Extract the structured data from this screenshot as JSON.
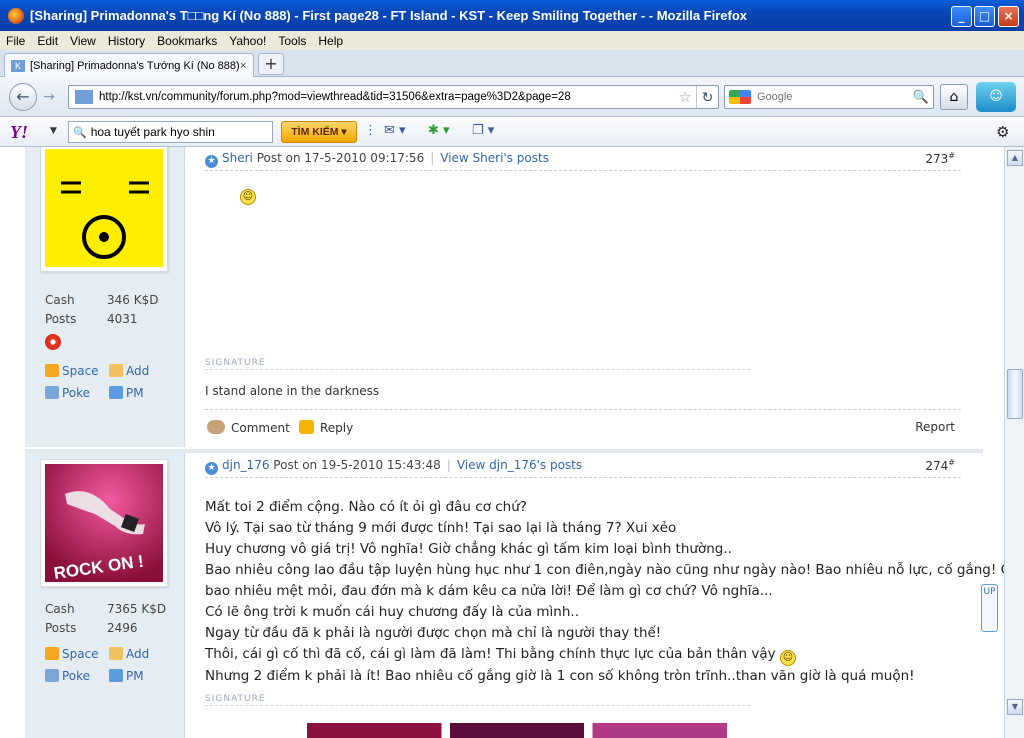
{
  "window": {
    "title": "[Sharing] Primadonna's T□□ng Kí (No 888) - First page28 - FT Island - KST - Keep Smiling Together - - Mozilla Firefox"
  },
  "menu": [
    "File",
    "Edit",
    "View",
    "History",
    "Bookmarks",
    "Yahoo!",
    "Tools",
    "Help"
  ],
  "tab": {
    "label": "[Sharing] Primadonna's Tướng Kí (No 888) - ...",
    "close": "×",
    "new_tab": "+"
  },
  "nav": {
    "url": "http://kst.vn/community/forum.php?mod=viewthread&tid=31506&extra=page%3D2&page=28",
    "search_placeholder": "Google"
  },
  "yahoo": {
    "logo": "Y!",
    "query": "hoa tuyết park hyo shin",
    "button": "TÌM KIẾM"
  },
  "posts": [
    {
      "author": "Sheri",
      "posted": "Post on 17-5-2010 09:17:56",
      "view_posts": "View Sheri's posts",
      "number": "273",
      "number_suffix": "#",
      "cash_label": "Cash",
      "cash": "346 K$D",
      "posts_label": "Posts",
      "posts": "4031",
      "actions": {
        "space": "Space",
        "add": "Add",
        "poke": "Poke",
        "pm": "PM"
      },
      "signature_label": "SIGNATURE",
      "signature": "I stand alone in the darkness",
      "footer": {
        "comment": "Comment",
        "reply": "Reply",
        "report": "Report"
      }
    },
    {
      "author": "djn_176",
      "posted": "Post on 19-5-2010 15:43:48",
      "view_posts": "View djn_176's posts",
      "number": "274",
      "number_suffix": "#",
      "cash_label": "Cash",
      "cash": "7365 K$D",
      "posts_label": "Posts",
      "posts": "2496",
      "actions": {
        "space": "Space",
        "add": "Add",
        "poke": "Poke",
        "pm": "PM"
      },
      "avatar_text": "ROCK ON !",
      "lines": [
        "Mất toi 2 điểm cộng. Nào có ít ỏi gì đâu cơ chứ?",
        "Vô lý. Tại sao từ tháng 9 mới được tính! Tại sao lại là tháng 7? Xui xẻo",
        "Huy chương vô giá trị! Vô nghĩa! Giờ chẳng khác gì tấm kim loại bình thường..",
        "Bao nhiêu công lao đầu tập luyện hùng hục như 1 con điên,ngày nào cũng như ngày nào! Bao nhiêu nỗ lực, cố gắng! Chịu",
        "bao nhiêu mệt mỏi, đau đớn mà k dám kêu ca nửa lời! Để làm gì cơ chứ? Vô nghĩa...",
        "Có lẽ ông trời k muốn cái huy chương đấy là của mình..",
        "Ngay từ đầu đã k phải là người được chọn mà chỉ là người thay thế!",
        "Thôi, cái gì cố thì đã cố, cái gì làm đã làm! Thi bằng chính thực lực của bản thân vậy",
        "Nhưng 2 điểm k phải là ít! Bao nhiêu cố gắng giờ là 1 con số không tròn trĩnh..than vãn giờ là quá muộn!"
      ],
      "signature_label": "SIGNATURE"
    }
  ],
  "float_button": "UP"
}
